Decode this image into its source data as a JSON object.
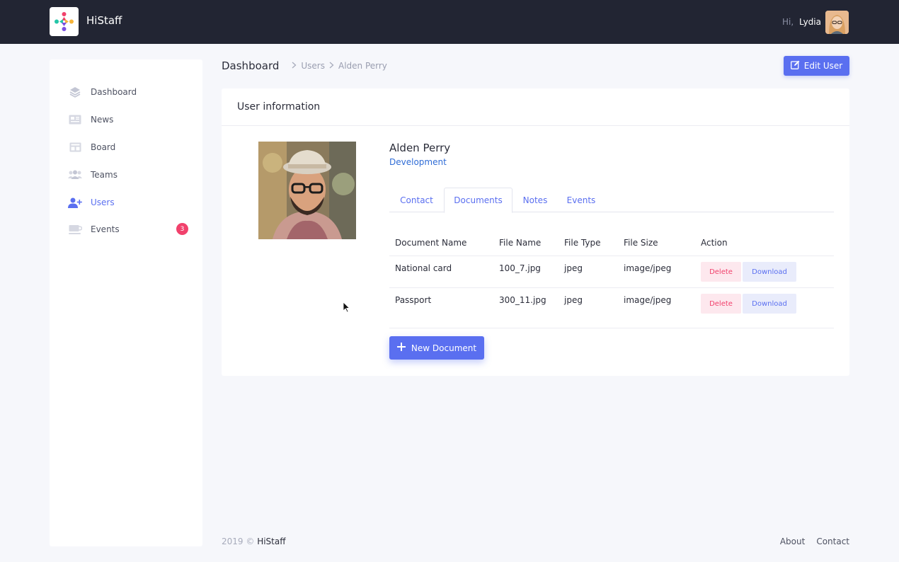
{
  "app": {
    "name": "HiStaff"
  },
  "header": {
    "greeting": "Hi,",
    "user_name": "Lydia"
  },
  "sidebar": {
    "items": [
      {
        "label": "Dashboard",
        "icon": "layers-icon"
      },
      {
        "label": "News",
        "icon": "newspaper-icon"
      },
      {
        "label": "Board",
        "icon": "board-icon"
      },
      {
        "label": "Teams",
        "icon": "teams-icon"
      },
      {
        "label": "Users",
        "icon": "user-plus-icon",
        "active": true
      },
      {
        "label": "Events",
        "icon": "coffee-icon",
        "badge": "3"
      }
    ]
  },
  "breadcrumb": {
    "home": "Dashboard",
    "items": [
      "Users",
      "Alden Perry"
    ]
  },
  "actions": {
    "edit_user": "Edit User",
    "new_document": "New Document"
  },
  "card": {
    "title": "User information",
    "user": {
      "name": "Alden Perry",
      "department": "Development"
    },
    "tabs": [
      "Contact",
      "Documents",
      "Notes",
      "Events"
    ],
    "active_tab": "Documents",
    "table": {
      "headers": [
        "Document Name",
        "File Name",
        "File Type",
        "File Size",
        "Action"
      ],
      "rows": [
        {
          "document_name": "National card",
          "file_name": "100_7.jpg",
          "file_type": "jpeg",
          "file_size": "image/jpeg",
          "delete": "Delete",
          "download": "Download"
        },
        {
          "document_name": "Passport",
          "file_name": "300_11.jpg",
          "file_type": "jpeg",
          "file_size": "image/jpeg",
          "delete": "Delete",
          "download": "Download"
        }
      ]
    }
  },
  "footer": {
    "year": "2019",
    "copyright": "©",
    "brand": "HiStaff",
    "links": [
      "About",
      "Contact"
    ]
  },
  "colors": {
    "accent": "#5a6ff0",
    "danger": "#f1416c",
    "topbar": "#222533",
    "link": "#2f6cd6"
  }
}
